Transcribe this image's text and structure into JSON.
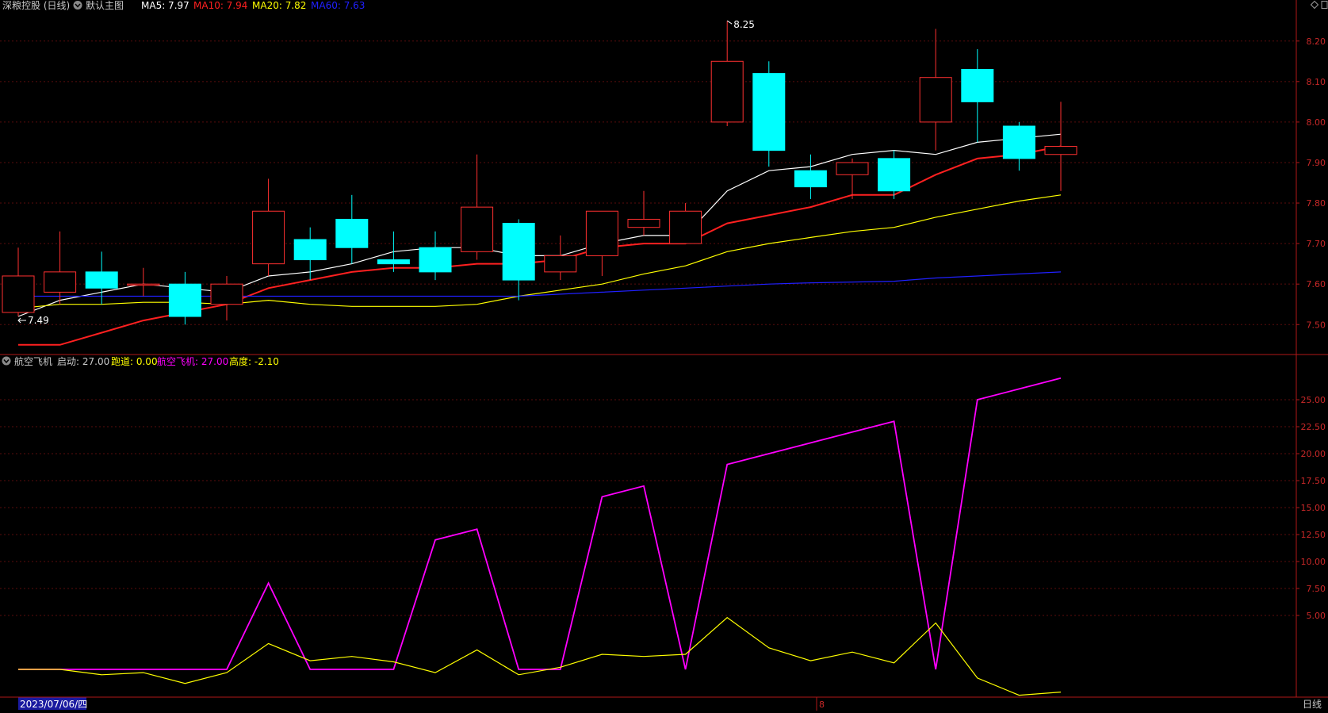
{
  "main_header": {
    "title": "深粮控股 (日线)",
    "template_label": "默认主图",
    "ma": [
      {
        "label": "MA5: 7.97",
        "color": "#ffffff"
      },
      {
        "label": "MA10: 7.94",
        "color": "#ff2020"
      },
      {
        "label": "MA20: 7.82",
        "color": "#ffff00"
      },
      {
        "label": "MA60: 7.63",
        "color": "#2020ff"
      }
    ]
  },
  "sub_header": {
    "title": "航空飞机",
    "items": [
      {
        "label": "启动: 27.00",
        "color": "#c8c8c8"
      },
      {
        "label": "跑道: 0.00",
        "color": "#ffff00"
      },
      {
        "label": "航空飞机: 27.00",
        "color": "#ff00ff"
      },
      {
        "label": "高度: -2.10",
        "color": "#ffff00"
      }
    ]
  },
  "bottom_bar": {
    "date_label": "2023/07/06/四",
    "month_marker": "8",
    "period_label": "日线"
  },
  "colors": {
    "up": "#ff3030",
    "down": "#00ffff",
    "axis": "#b01818",
    "axis_text": "#c82828",
    "grid": "#5a0c0c",
    "ma5": "#ffffff",
    "ma10": "#ff2020",
    "ma20": "#ffff00",
    "ma60": "#2020ff",
    "plane": "#ff00ff",
    "runway": "#ffff00"
  },
  "chart_data": [
    {
      "type": "candlestick",
      "ylim": [
        7.43,
        8.27
      ],
      "y_ticks": [
        7.5,
        7.6,
        7.7,
        7.8,
        7.9,
        8.0,
        8.1,
        8.2
      ],
      "y_tick_labels": [
        "7.50",
        "7.60",
        "7.70",
        "7.80",
        "7.90",
        "8.00",
        "8.10",
        "8.20"
      ],
      "grid": true,
      "annotations": [
        {
          "text": "8.25",
          "index": 17,
          "value": 8.25
        },
        {
          "text": "7.49",
          "index": 0,
          "value": 7.52
        }
      ],
      "candles": [
        {
          "o": 7.53,
          "c": 7.62,
          "h": 7.69,
          "l": 7.52
        },
        {
          "o": 7.58,
          "c": 7.63,
          "h": 7.73,
          "l": 7.55
        },
        {
          "o": 7.63,
          "c": 7.59,
          "h": 7.68,
          "l": 7.55
        },
        {
          "o": 7.6,
          "c": 7.6,
          "h": 7.64,
          "l": 7.57
        },
        {
          "o": 7.6,
          "c": 7.52,
          "h": 7.63,
          "l": 7.5
        },
        {
          "o": 7.55,
          "c": 7.6,
          "h": 7.62,
          "l": 7.51
        },
        {
          "o": 7.65,
          "c": 7.78,
          "h": 7.86,
          "l": 7.62
        },
        {
          "o": 7.71,
          "c": 7.66,
          "h": 7.74,
          "l": 7.61
        },
        {
          "o": 7.76,
          "c": 7.69,
          "h": 7.82,
          "l": 7.65
        },
        {
          "o": 7.66,
          "c": 7.65,
          "h": 7.73,
          "l": 7.63
        },
        {
          "o": 7.69,
          "c": 7.63,
          "h": 7.73,
          "l": 7.61
        },
        {
          "o": 7.68,
          "c": 7.79,
          "h": 7.92,
          "l": 7.66
        },
        {
          "o": 7.75,
          "c": 7.61,
          "h": 7.76,
          "l": 7.56
        },
        {
          "o": 7.63,
          "c": 7.67,
          "h": 7.72,
          "l": 7.61
        },
        {
          "o": 7.67,
          "c": 7.78,
          "h": 7.78,
          "l": 7.62
        },
        {
          "o": 7.74,
          "c": 7.76,
          "h": 7.83,
          "l": 7.72
        },
        {
          "o": 7.7,
          "c": 7.78,
          "h": 7.8,
          "l": 7.7
        },
        {
          "o": 8.0,
          "c": 8.15,
          "h": 8.25,
          "l": 7.99
        },
        {
          "o": 8.12,
          "c": 7.93,
          "h": 8.15,
          "l": 7.89
        },
        {
          "o": 7.88,
          "c": 7.84,
          "h": 7.92,
          "l": 7.81
        },
        {
          "o": 7.87,
          "c": 7.9,
          "h": 7.91,
          "l": 7.81
        },
        {
          "o": 7.91,
          "c": 7.83,
          "h": 7.93,
          "l": 7.81
        },
        {
          "o": 8.0,
          "c": 8.11,
          "h": 8.23,
          "l": 7.93
        },
        {
          "o": 8.13,
          "c": 8.05,
          "h": 8.18,
          "l": 7.95
        },
        {
          "o": 7.99,
          "c": 7.91,
          "h": 8.0,
          "l": 7.88
        },
        {
          "o": 7.92,
          "c": 7.94,
          "h": 8.05,
          "l": 7.83
        }
      ],
      "series": [
        {
          "name": "MA5",
          "values": [
            7.52,
            7.56,
            7.58,
            7.6,
            7.59,
            7.58,
            7.62,
            7.63,
            7.65,
            7.68,
            7.69,
            7.69,
            7.67,
            7.67,
            7.7,
            7.72,
            7.72,
            7.83,
            7.88,
            7.89,
            7.92,
            7.93,
            7.92,
            7.95,
            7.96,
            7.97
          ]
        },
        {
          "name": "MA10",
          "values": [
            7.45,
            7.45,
            7.48,
            7.51,
            7.53,
            7.55,
            7.59,
            7.61,
            7.63,
            7.64,
            7.64,
            7.65,
            7.65,
            7.66,
            7.69,
            7.7,
            7.7,
            7.75,
            7.77,
            7.79,
            7.82,
            7.82,
            7.87,
            7.91,
            7.92,
            7.94
          ]
        },
        {
          "name": "MA20",
          "values": [
            7.54,
            7.55,
            7.55,
            7.555,
            7.555,
            7.55,
            7.56,
            7.55,
            7.545,
            7.545,
            7.545,
            7.55,
            7.57,
            7.585,
            7.6,
            7.625,
            7.645,
            7.68,
            7.7,
            7.715,
            7.73,
            7.74,
            7.765,
            7.785,
            7.805,
            7.82
          ]
        },
        {
          "name": "MA60",
          "values": [
            7.57,
            7.57,
            7.57,
            7.57,
            7.57,
            7.57,
            7.57,
            7.57,
            7.57,
            7.57,
            7.57,
            7.57,
            7.57,
            7.575,
            7.58,
            7.585,
            7.59,
            7.595,
            7.6,
            7.603,
            7.605,
            7.607,
            7.615,
            7.62,
            7.625,
            7.63
          ]
        }
      ]
    },
    {
      "type": "line",
      "ylim": [
        -2.5,
        27.5
      ],
      "y_ticks": [
        5,
        7.5,
        10,
        12.5,
        15,
        17.5,
        20,
        22.5,
        25
      ],
      "y_tick_labels": [
        "5.00",
        "7.50",
        "10.00",
        "12.50",
        "15.00",
        "17.50",
        "20.00",
        "22.50",
        "25.00"
      ],
      "grid": true,
      "series": [
        {
          "name": "航空飞机",
          "values": [
            0,
            0,
            0,
            0,
            0,
            0,
            8,
            0,
            0,
            0,
            12,
            13,
            0,
            0,
            16,
            17,
            0,
            19,
            20,
            21,
            22,
            23,
            0,
            25,
            26,
            27
          ]
        },
        {
          "name": "跑道",
          "values": [
            0,
            0,
            -0.5,
            -0.3,
            -1.3,
            -0.3,
            2.4,
            0.8,
            1.2,
            0.7,
            -0.3,
            1.8,
            -0.5,
            0.2,
            1.4,
            1.2,
            1.4,
            4.8,
            2,
            0.8,
            1.6,
            0.6,
            4.3,
            -0.8,
            -2.4,
            -2.1
          ]
        }
      ]
    }
  ]
}
